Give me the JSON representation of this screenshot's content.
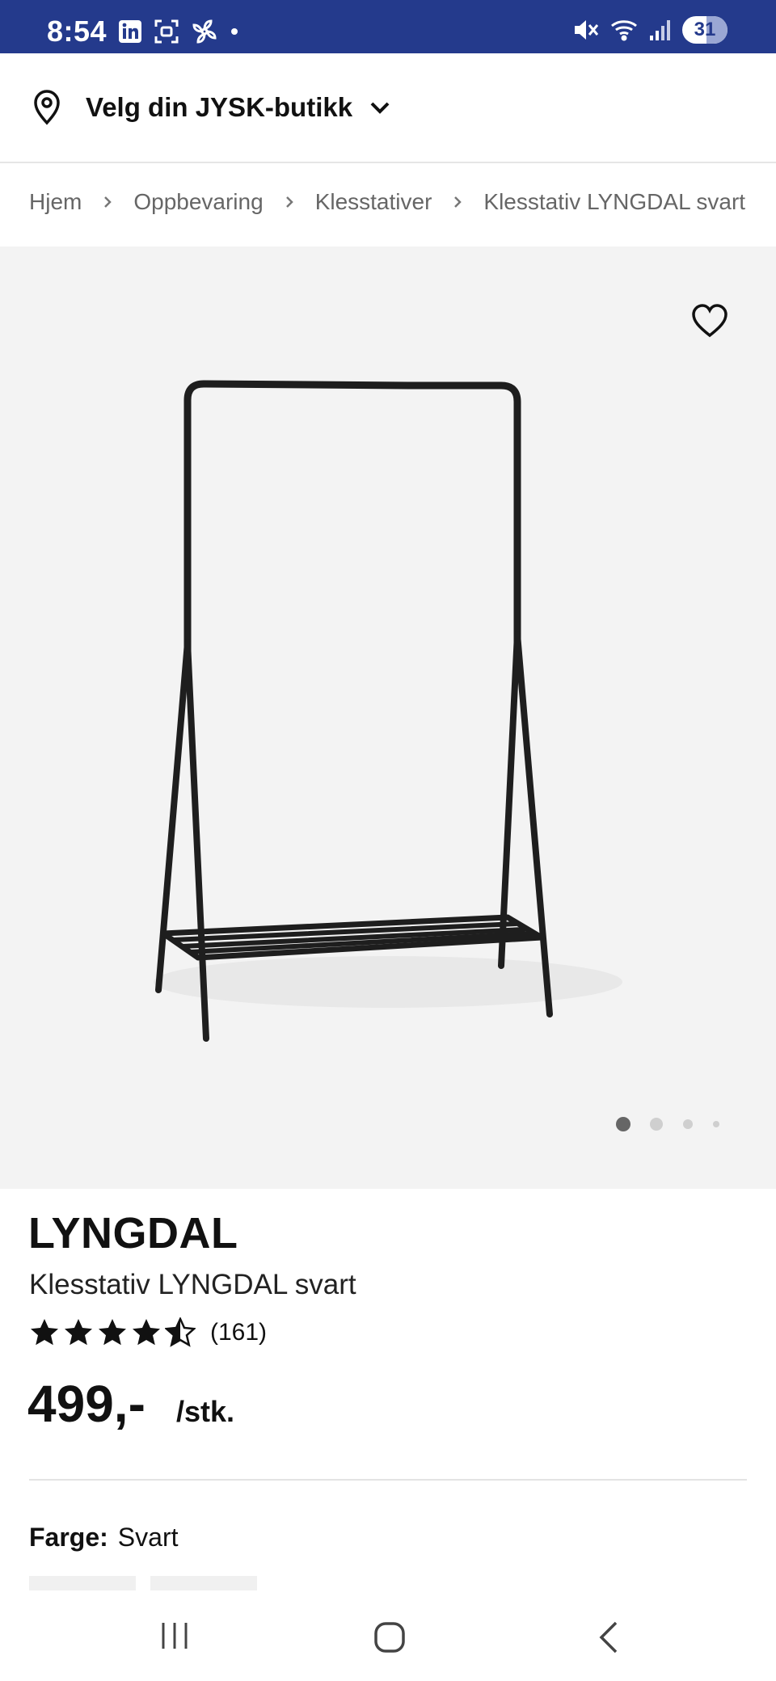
{
  "status_bar": {
    "time": "8:54",
    "battery": "31",
    "background": "#243a8c"
  },
  "store_selector": {
    "label": "Velg din JYSK-butikk",
    "pin_icon": "location-pin-icon",
    "chevron_icon": "chevron-down-icon"
  },
  "breadcrumb": {
    "items": [
      "Hjem",
      "Oppbevaring",
      "Klesstativer",
      "Klesstativ LYNGDAL svart"
    ]
  },
  "gallery": {
    "image_alt": "Klesstativ LYNGDAL svart",
    "wishlist_icon": "heart-icon",
    "slide_count": 4,
    "active_slide": 1
  },
  "product": {
    "brand": "LYNGDAL",
    "name": "Klesstativ LYNGDAL svart",
    "rating": 4.5,
    "rating_max": 5,
    "rating_count": "(161)",
    "price": "499,-",
    "price_unit": "/stk.",
    "color_label": "Farge:",
    "color_value": "Svart"
  },
  "nav_bar": {
    "recent_icon": "recent-apps-icon",
    "home_icon": "home-icon",
    "back_icon": "back-icon"
  }
}
